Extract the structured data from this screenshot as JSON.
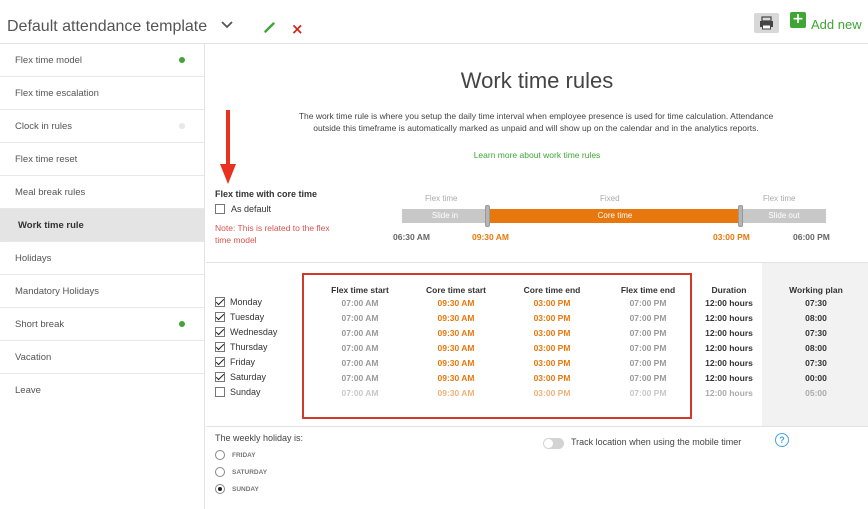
{
  "header": {
    "template_title": "Default attendance template",
    "add_label": "Add new",
    "add_icon": "+",
    "close_glyph": "×"
  },
  "sidebar": {
    "items": [
      {
        "label": "Flex time model",
        "status_dot": "#3fa535"
      },
      {
        "label": "Flex time escalation",
        "status_dot": ""
      },
      {
        "label": "Clock in rules",
        "status_dot": "#e8e8e8"
      },
      {
        "label": "Flex time reset",
        "status_dot": ""
      },
      {
        "label": "Meal break rules",
        "status_dot": ""
      },
      {
        "label": "Work time rule",
        "status_dot": "",
        "active": true
      },
      {
        "label": "Holidays",
        "status_dot": ""
      },
      {
        "label": "Mandatory Holidays",
        "status_dot": ""
      },
      {
        "label": "Short break",
        "status_dot": "#3fa535"
      },
      {
        "label": "Vacation",
        "status_dot": ""
      },
      {
        "label": "Leave",
        "status_dot": ""
      }
    ]
  },
  "main": {
    "title": "Work time rules",
    "description": "The work time rule is where you setup the daily time interval when employee presence is used for time calculation. Attendance outside this timeframe is automatically marked as unpaid and will show up on the calendar and in the analytics reports.",
    "learn_more": "Learn more about work time rules",
    "flex_section": {
      "title": "Flex time with core time",
      "as_default_label": "As default",
      "as_default_checked": false,
      "note": "Note: This is related to the flex time model"
    },
    "timeline": {
      "flex_left_label": "Flex time",
      "fixed_label": "Fixed",
      "flex_right_label": "Flex time",
      "slide_in": "Slide in",
      "core_time": "Core time",
      "slide_out": "Slide out",
      "times": [
        "06:30 AM",
        "09:30 AM",
        "03:00 PM",
        "06:00 PM"
      ]
    },
    "table": {
      "columns": [
        "Flex time start",
        "Core time start",
        "Core time end",
        "Flex time end",
        "Duration",
        "Working plan"
      ],
      "rows": [
        {
          "day": "Monday",
          "checked": true,
          "flex_start": "07:00 AM",
          "core_start": "09:30 AM",
          "core_end": "03:00 PM",
          "flex_end": "07:00 PM",
          "duration": "12:00 hours",
          "plan": "07:30"
        },
        {
          "day": "Tuesday",
          "checked": true,
          "flex_start": "07:00 AM",
          "core_start": "09:30 AM",
          "core_end": "03:00 PM",
          "flex_end": "07:00 PM",
          "duration": "12:00 hours",
          "plan": "08:00"
        },
        {
          "day": "Wednesday",
          "checked": true,
          "flex_start": "07:00 AM",
          "core_start": "09:30 AM",
          "core_end": "03:00 PM",
          "flex_end": "07:00 PM",
          "duration": "12:00 hours",
          "plan": "07:30"
        },
        {
          "day": "Thursday",
          "checked": true,
          "flex_start": "07:00 AM",
          "core_start": "09:30 AM",
          "core_end": "03:00 PM",
          "flex_end": "07:00 PM",
          "duration": "12:00 hours",
          "plan": "08:00"
        },
        {
          "day": "Friday",
          "checked": true,
          "flex_start": "07:00 AM",
          "core_start": "09:30 AM",
          "core_end": "03:00 PM",
          "flex_end": "07:00 PM",
          "duration": "12:00 hours",
          "plan": "07:30"
        },
        {
          "day": "Saturday",
          "checked": true,
          "flex_start": "07:00 AM",
          "core_start": "09:30 AM",
          "core_end": "03:00 PM",
          "flex_end": "07:00 PM",
          "duration": "12:00 hours",
          "plan": "00:00"
        },
        {
          "day": "Sunday",
          "checked": false,
          "flex_start": "07:00 AM",
          "core_start": "09:30 AM",
          "core_end": "03:00 PM",
          "flex_end": "07:00 PM",
          "duration": "12:00 hours",
          "plan": "05:00"
        }
      ]
    },
    "weekly_holiday": {
      "label": "The weekly holiday is:",
      "options": [
        "FRIDAY",
        "SATURDAY",
        "SUNDAY"
      ],
      "selected": "SUNDAY"
    },
    "track_location": {
      "label": "Track location when using the mobile timer",
      "enabled": false,
      "help_glyph": "?"
    }
  },
  "colors": {
    "accent_green": "#3fa535",
    "core_orange": "#e8780e",
    "error_red": "#d9534f",
    "annotation_red": "#cf3a2a"
  }
}
